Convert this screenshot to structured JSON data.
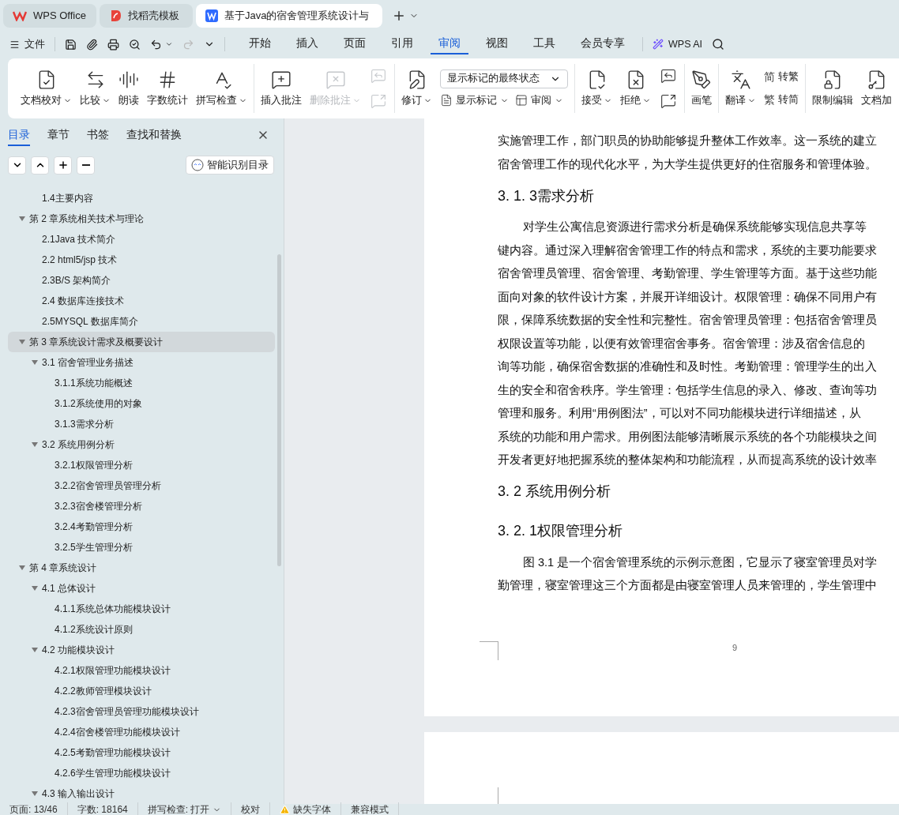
{
  "title_tabs": [
    {
      "label": "WPS Office",
      "kind": "wps",
      "selected": false
    },
    {
      "label": "找稻壳模板",
      "kind": "docer",
      "selected": false
    },
    {
      "label": "基于Java的宿舍管理系统设计与",
      "kind": "doc",
      "selected": true
    }
  ],
  "menu": {
    "file": "文件",
    "tabs": [
      {
        "label": "开始",
        "selected": false
      },
      {
        "label": "插入",
        "selected": false
      },
      {
        "label": "页面",
        "selected": false
      },
      {
        "label": "引用",
        "selected": false
      },
      {
        "label": "审阅",
        "selected": true
      },
      {
        "label": "视图",
        "selected": false
      },
      {
        "label": "工具",
        "selected": false
      },
      {
        "label": "会员专享",
        "selected": false
      }
    ],
    "ai": "WPS AI"
  },
  "ribbon": [
    [
      {
        "kind": "large",
        "label": "文档校对",
        "caret": true,
        "disabled": false
      },
      {
        "kind": "large",
        "label": "比较",
        "caret": true,
        "disabled": false
      },
      {
        "kind": "large",
        "label": "朗读",
        "caret": false,
        "disabled": false
      },
      {
        "kind": "large",
        "label": "字数统计",
        "caret": false,
        "disabled": false
      },
      {
        "kind": "large",
        "label": "拼写检查",
        "caret": true,
        "disabled": false
      }
    ],
    [
      {
        "kind": "large",
        "label": "插入批注",
        "caret": false,
        "disabled": false
      },
      {
        "kind": "large",
        "label": "删除批注",
        "caret": true,
        "disabled": true
      },
      {
        "kind": "iconcol",
        "disabled": true
      }
    ],
    [
      {
        "kind": "large",
        "label": "修订",
        "caret": true,
        "disabled": false
      },
      {
        "kind": "markup",
        "select": "显示标记的最终状态",
        "buttons": [
          "显示标记",
          "审阅"
        ]
      }
    ],
    [
      {
        "kind": "large",
        "label": "接受",
        "caret": true,
        "disabled": false
      },
      {
        "kind": "large",
        "label": "拒绝",
        "caret": true,
        "disabled": false
      },
      {
        "kind": "iconcol",
        "disabled": false
      }
    ],
    [
      {
        "kind": "large",
        "label": "画笔",
        "caret": false,
        "disabled": false
      }
    ],
    [
      {
        "kind": "large",
        "label": "翻译",
        "caret": true,
        "disabled": false
      },
      {
        "kind": "smallcol",
        "buttons": [
          {
            "glyph": "简",
            "label": "转繁"
          },
          {
            "glyph": "繁",
            "label": "转简"
          }
        ]
      }
    ],
    [
      {
        "kind": "large",
        "label": "限制编辑",
        "caret": false,
        "disabled": false
      },
      {
        "kind": "large",
        "label": "文档加",
        "caret": false,
        "disabled": false
      }
    ]
  ],
  "nav": {
    "tabs": [
      {
        "label": "目录",
        "selected": true
      },
      {
        "label": "章节",
        "selected": false
      },
      {
        "label": "书签",
        "selected": false
      },
      {
        "label": "查找和替换",
        "selected": false
      }
    ],
    "smart_button": "智能识别目录"
  },
  "toc_continued": [
    {
      "label": "1.4主要内容",
      "selected": false
    }
  ],
  "toc": [
    {
      "label": "第 2 章系统相关技术与理论",
      "selected": false,
      "expanded": true,
      "children": [
        {
          "label": "2.1Java 技术简介",
          "selected": false
        },
        {
          "label": "2.2 html5/jsp 技术",
          "selected": false
        },
        {
          "label": "2.3B/S  架构简介",
          "selected": false
        },
        {
          "label": "2.4 数据库连接技术",
          "selected": false
        },
        {
          "label": "2.5MYSQL 数据库简介",
          "selected": false
        }
      ]
    },
    {
      "label": "第 3 章系统设计需求及概要设计",
      "selected": true,
      "expanded": true,
      "children": [
        {
          "label": "3.1 宿舍管理业务描述",
          "selected": false,
          "expanded": true,
          "children": [
            {
              "label": "3.1.1系统功能概述",
              "selected": false
            },
            {
              "label": "3.1.2系统使用的对象",
              "selected": false
            },
            {
              "label": "3.1.3需求分析",
              "selected": false
            }
          ]
        },
        {
          "label": "3.2 系统用例分析",
          "selected": false,
          "expanded": true,
          "children": [
            {
              "label": "3.2.1权限管理分析",
              "selected": false
            },
            {
              "label": "3.2.2宿舍管理员管理分析",
              "selected": false
            },
            {
              "label": "3.2.3宿舍楼管理分析",
              "selected": false
            },
            {
              "label": "3.2.4考勤管理分析",
              "selected": false
            },
            {
              "label": "3.2.5学生管理分析",
              "selected": false
            }
          ]
        }
      ]
    },
    {
      "label": "第 4 章系统设计",
      "selected": false,
      "expanded": true,
      "children": [
        {
          "label": "4.1 总体设计",
          "selected": false,
          "expanded": true,
          "children": [
            {
              "label": "4.1.1系统总体功能模块设计",
              "selected": false
            },
            {
              "label": "4.1.2系统设计原则",
              "selected": false
            }
          ]
        },
        {
          "label": "4.2 功能模块设计",
          "selected": false,
          "expanded": true,
          "children": [
            {
              "label": "4.2.1权限管理功能模块设计",
              "selected": false
            },
            {
              "label": "4.2.2教师管理模块设计",
              "selected": false
            },
            {
              "label": "4.2.3宿舍管理员管理功能模块设计",
              "selected": false
            },
            {
              "label": "4.2.4宿舍楼管理功能模块设计",
              "selected": false
            },
            {
              "label": "4.2.5考勤管理功能模块设计",
              "selected": false
            },
            {
              "label": "4.2.6学生管理功能模块设计",
              "selected": false
            }
          ]
        },
        {
          "label": "4.3 输入输出设计",
          "selected": false,
          "expanded": true
        }
      ]
    }
  ],
  "document": [
    {
      "kind": "line",
      "text": "实施管理工作，部门职员的协助能够提升整体工作效率。这一系统的建立"
    },
    {
      "kind": "line",
      "text": "宿舍管理工作的现代化水平，为大学生提供更好的住宿服务和管理体验。"
    },
    {
      "kind": "heading",
      "text": "3. 1. 3需求分析"
    },
    {
      "kind": "first",
      "text": "对学生公寓信息资源进行需求分析是确保系统能够实现信息共享等"
    },
    {
      "kind": "line",
      "text": "键内容。通过深入理解宿舍管理工作的特点和需求，系统的主要功能要求"
    },
    {
      "kind": "line",
      "text": "宿舍管理员管理、宿舍管理、考勤管理、学生管理等方面。基于这些功能"
    },
    {
      "kind": "line",
      "text": "面向对象的软件设计方案，并展开详细设计。权限管理：确保不同用户有"
    },
    {
      "kind": "line",
      "text": "限，保障系统数据的安全性和完整性。宿舍管理员管理：包括宿舍管理员"
    },
    {
      "kind": "line",
      "text": "权限设置等功能，以便有效管理宿舍事务。宿舍管理：涉及宿舍信息的"
    },
    {
      "kind": "line",
      "text": "询等功能，确保宿舍数据的准确性和及时性。考勤管理：管理学生的出入"
    },
    {
      "kind": "line",
      "text": "生的安全和宿舍秩序。学生管理：包括学生信息的录入、修改、查询等功"
    },
    {
      "kind": "line",
      "text": "管理和服务。利用“用例图法”，可以对不同功能模块进行详细描述，从"
    },
    {
      "kind": "line",
      "text": "系统的功能和用户需求。用例图法能够清晰展示系统的各个功能模块之间"
    },
    {
      "kind": "line",
      "text": "开发者更好地把握系统的整体架构和功能流程，从而提高系统的设计效率"
    },
    {
      "kind": "heading",
      "text": "3. 2 系统用例分析"
    },
    {
      "kind": "heading",
      "text": "3. 2. 1权限管理分析"
    },
    {
      "kind": "first",
      "text": "图 3.1 是一个宿舍管理系统的示例示意图，它显示了寝室管理员对学"
    },
    {
      "kind": "line",
      "text": "勤管理，寝室管理这三个方面都是由寝室管理人员来管理的，学生管理中"
    }
  ],
  "page_number": "9",
  "status_bar": [
    {
      "kind": "text",
      "text": "页面: 13/46"
    },
    {
      "kind": "text",
      "text": "字数: 18164"
    },
    {
      "kind": "dropdown",
      "text": "拼写检查: 打开"
    },
    {
      "kind": "text",
      "text": "校对"
    },
    {
      "kind": "warning",
      "text": "缺失字体"
    },
    {
      "kind": "text",
      "text": "兼容模式"
    }
  ]
}
